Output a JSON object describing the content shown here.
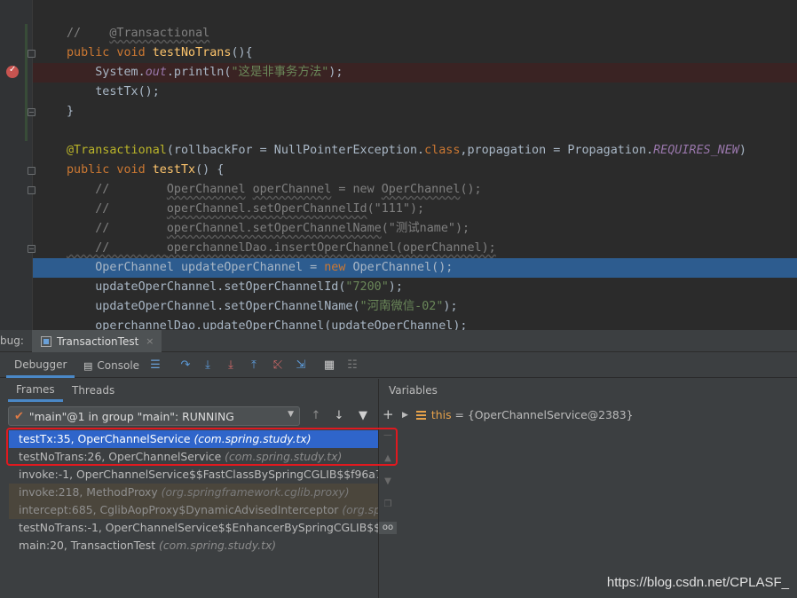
{
  "editor": {
    "lines": [
      {
        "segments": [
          {
            "t": "//",
            "c": "cmt"
          },
          {
            "t": "    ",
            "c": "cmt"
          },
          {
            "t": "@Transactional",
            "c": "cmt wavy"
          }
        ]
      },
      {
        "segments": [
          {
            "t": "public void ",
            "c": "kw"
          },
          {
            "t": "testNoTrans",
            "c": "fn"
          },
          {
            "t": "(){",
            "c": ""
          }
        ]
      },
      {
        "segments": [
          {
            "t": "    System.",
            "c": ""
          },
          {
            "t": "out",
            "c": "fld"
          },
          {
            "t": ".println(",
            "c": ""
          },
          {
            "t": "\"这是非事务方法\"",
            "c": "str"
          },
          {
            "t": ");",
            "c": ""
          }
        ]
      },
      {
        "segments": [
          {
            "t": "    testTx();",
            "c": ""
          }
        ]
      },
      {
        "segments": [
          {
            "t": "}",
            "c": ""
          }
        ]
      },
      {
        "segments": [
          {
            "t": "",
            "c": ""
          }
        ]
      },
      {
        "segments": [
          {
            "t": "@Transactional",
            "c": "ann"
          },
          {
            "t": "(rollbackFor = NullPointerException.",
            "c": ""
          },
          {
            "t": "class",
            "c": "kw"
          },
          {
            "t": ",propagation = Propagation.",
            "c": ""
          },
          {
            "t": "REQUIRES_NEW",
            "c": "fld"
          },
          {
            "t": ")",
            "c": ""
          }
        ]
      },
      {
        "segments": [
          {
            "t": "public void ",
            "c": "kw"
          },
          {
            "t": "testTx",
            "c": "fn"
          },
          {
            "t": "() {",
            "c": ""
          }
        ]
      },
      {
        "segments": [
          {
            "t": "    //        ",
            "c": "cmt"
          },
          {
            "t": "OperChannel",
            "c": "cmt wavy"
          },
          {
            "t": " ",
            "c": "cmt"
          },
          {
            "t": "operChannel",
            "c": "cmt wavy"
          },
          {
            "t": " = new ",
            "c": "cmt"
          },
          {
            "t": "OperChannel",
            "c": "cmt wavy"
          },
          {
            "t": "();",
            "c": "cmt"
          }
        ]
      },
      {
        "segments": [
          {
            "t": "    //        ",
            "c": "cmt"
          },
          {
            "t": "operChannel.setOperChannelId",
            "c": "cmt wavy"
          },
          {
            "t": "(\"111\");",
            "c": "cmt"
          }
        ]
      },
      {
        "segments": [
          {
            "t": "    //        ",
            "c": "cmt"
          },
          {
            "t": "operChannel.setOperChannelName",
            "c": "cmt wavy"
          },
          {
            "t": "(\"测试name\");",
            "c": "cmt"
          }
        ]
      },
      {
        "segments": [
          {
            "t": "    //        ",
            "c": "cmt wavy"
          },
          {
            "t": "operchannelDao.insertOperChannel(operChannel);",
            "c": "cmt wavy"
          }
        ]
      },
      {
        "segments": [
          {
            "t": "    OperChannel updateOperChannel = ",
            "c": ""
          },
          {
            "t": "new ",
            "c": "kw"
          },
          {
            "t": "OperChannel();",
            "c": ""
          }
        ]
      },
      {
        "segments": [
          {
            "t": "    updateOperChannel.setOperChannelId(",
            "c": ""
          },
          {
            "t": "\"7200\"",
            "c": "str"
          },
          {
            "t": ");",
            "c": ""
          }
        ]
      },
      {
        "segments": [
          {
            "t": "    updateOperChannel.setOperChannelName(",
            "c": ""
          },
          {
            "t": "\"河南微信-02\"",
            "c": "str"
          },
          {
            "t": ");",
            "c": ""
          }
        ]
      },
      {
        "segments": [
          {
            "t": "    operchannelDao.updateOperChannel(updateOperChannel);",
            "c": "wavy"
          }
        ]
      }
    ]
  },
  "debug": {
    "label": "bug:",
    "run_tab": "TransactionTest",
    "run_tab_close": "×",
    "tabs": {
      "debugger": "Debugger",
      "console": "Console"
    },
    "frames_tab": "Frames",
    "threads_tab": "Threads",
    "variables_title": "Variables",
    "thread_selector": "\"main\"@1 in group \"main\": RUNNING",
    "frames": [
      {
        "method": "testTx:35, OperChannelService ",
        "pkg": "(com.spring.study.tx)",
        "state": "selected"
      },
      {
        "method": "testNoTrans:26, OperChannelService ",
        "pkg": "(com.spring.study.tx)",
        "state": "normal"
      },
      {
        "method": "invoke:-1, OperChannelService$$FastClassBySpringCGLIB$$f96a7",
        "pkg": "",
        "state": "normal"
      },
      {
        "method": "invoke:218, MethodProxy ",
        "pkg": "(org.springframework.cglib.proxy)",
        "state": "lib"
      },
      {
        "method": "intercept:685, CglibAopProxy$DynamicAdvisedInterceptor ",
        "pkg": "(org.sp",
        "state": "lib"
      },
      {
        "method": "testNoTrans:-1, OperChannelService$$EnhancerBySpringCGLIB$$",
        "pkg": "",
        "state": "normal"
      },
      {
        "method": "main:20, TransactionTest ",
        "pkg": "(com.spring.study.tx)",
        "state": "normal"
      }
    ],
    "variable": {
      "name": "this",
      "value": "= {OperChannelService@2383}"
    }
  },
  "watermark": "https://blog.csdn.net/CPLASF_",
  "colors": {
    "background": "#2b2b2b",
    "panel": "#3c3f41",
    "selection": "#2f65ca",
    "execution_line": "#2d5c8f",
    "breakpoint": "#c75450",
    "annotation_box": "#e0191f"
  }
}
